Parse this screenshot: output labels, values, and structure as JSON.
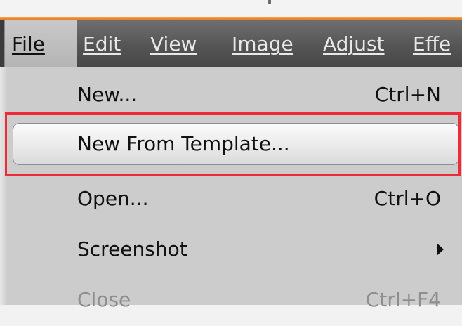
{
  "menubar": {
    "items": [
      {
        "label": "File",
        "active": true
      },
      {
        "label": "Edit",
        "active": false
      },
      {
        "label": "View",
        "active": false
      },
      {
        "label": "Image",
        "active": false
      },
      {
        "label": "Adjust",
        "active": false
      },
      {
        "label": "Effe",
        "active": false
      }
    ]
  },
  "file_menu": {
    "entries": [
      {
        "label": "New...",
        "shortcut": "Ctrl+N",
        "highlighted": false,
        "enabled": true
      },
      {
        "label": "New From Template...",
        "shortcut": "",
        "highlighted": true,
        "enabled": true
      },
      {
        "label": "Open...",
        "shortcut": "Ctrl+O",
        "highlighted": false,
        "enabled": true
      },
      {
        "label": "Screenshot",
        "shortcut": "",
        "submenu": true,
        "highlighted": false,
        "enabled": true
      },
      {
        "label": "Close",
        "shortcut": "Ctrl+F4",
        "highlighted": false,
        "enabled": false
      }
    ]
  },
  "colors": {
    "accent_bar": "#e3731f",
    "annotation_box": "#ee2b36",
    "menu_background": "#cccccc",
    "menubar_background": "#555555"
  }
}
